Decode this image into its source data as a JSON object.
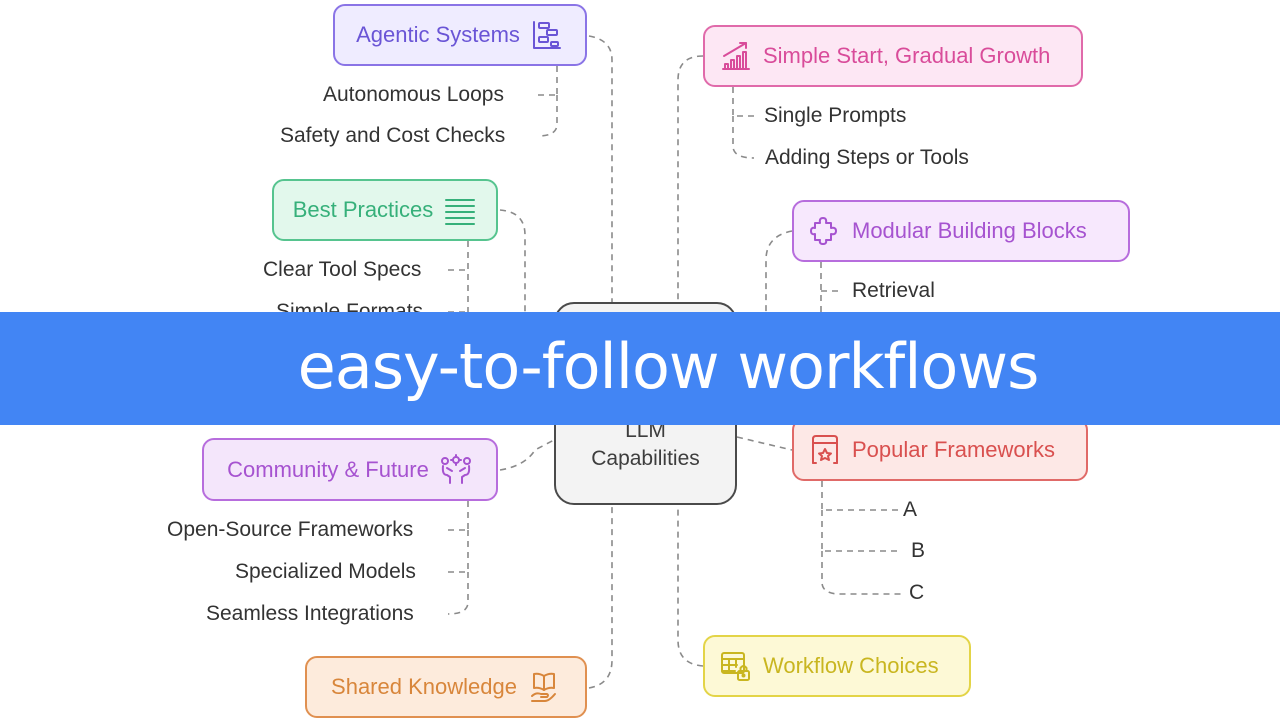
{
  "diagram": {
    "center": {
      "line1": "LLM",
      "line2": "Capabilities"
    },
    "branches": {
      "agentic": {
        "label": "Agentic Systems",
        "icon": "gantt-chart-icon",
        "color": "#6a55d6",
        "children": [
          "Autonomous Loops",
          "Safety and Cost Checks"
        ]
      },
      "simple": {
        "label": "Simple Start, Gradual Growth",
        "icon": "growth-chart-icon",
        "color": "#d94c9a",
        "children": [
          "Single Prompts",
          "Adding Steps or Tools"
        ]
      },
      "best": {
        "label": "Best Practices",
        "icon": "list-lines-icon",
        "color": "#36b07a",
        "children": [
          "Clear Tool Specs",
          "Simple Formats"
        ]
      },
      "modular": {
        "label": "Modular Building Blocks",
        "icon": "puzzle-piece-icon",
        "color": "#a653d0",
        "children": [
          "Retrieval"
        ]
      },
      "community": {
        "label": "Community & Future",
        "icon": "people-collaboration-icon",
        "color": "#a653d0",
        "children": [
          "Open-Source Frameworks",
          "Specialized Models",
          "Seamless Integrations"
        ]
      },
      "popular": {
        "label": "Popular Frameworks",
        "icon": "window-star-icon",
        "color": "#d9504f",
        "children": [
          "A",
          "B",
          "C"
        ]
      },
      "shared": {
        "label": "Shared Knowledge",
        "icon": "book-hand-icon",
        "color": "#d8863b"
      },
      "workflow": {
        "label": "Workflow Choices",
        "icon": "table-lock-icon",
        "color": "#c9b620"
      }
    }
  },
  "banner": {
    "text": "easy-to-follow workflows",
    "color": "#4285f4"
  }
}
